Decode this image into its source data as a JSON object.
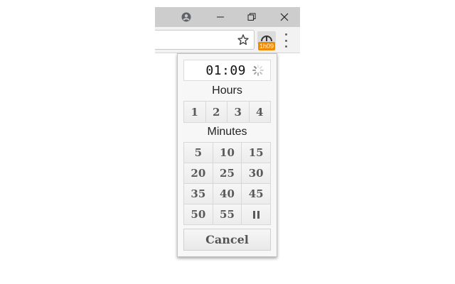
{
  "browser": {
    "icons": {
      "profile": "profile-icon",
      "minimize": "minimize-icon",
      "restore": "restore-icon",
      "close": "close-icon",
      "bookmark": "star-icon",
      "menu": "kebab-menu-icon",
      "extension": "timer-extension-icon"
    },
    "extension_badge": "1h09",
    "badge_color": "#f08a00"
  },
  "popup": {
    "timer": "01:09",
    "hours_label": "Hours",
    "hours": [
      "1",
      "2",
      "3",
      "4"
    ],
    "minutes_label": "Minutes",
    "minutes": [
      "5",
      "10",
      "15",
      "20",
      "25",
      "30",
      "35",
      "40",
      "45",
      "50",
      "55"
    ],
    "pause_icon": "pause-icon",
    "cancel_label": "Cancel"
  }
}
